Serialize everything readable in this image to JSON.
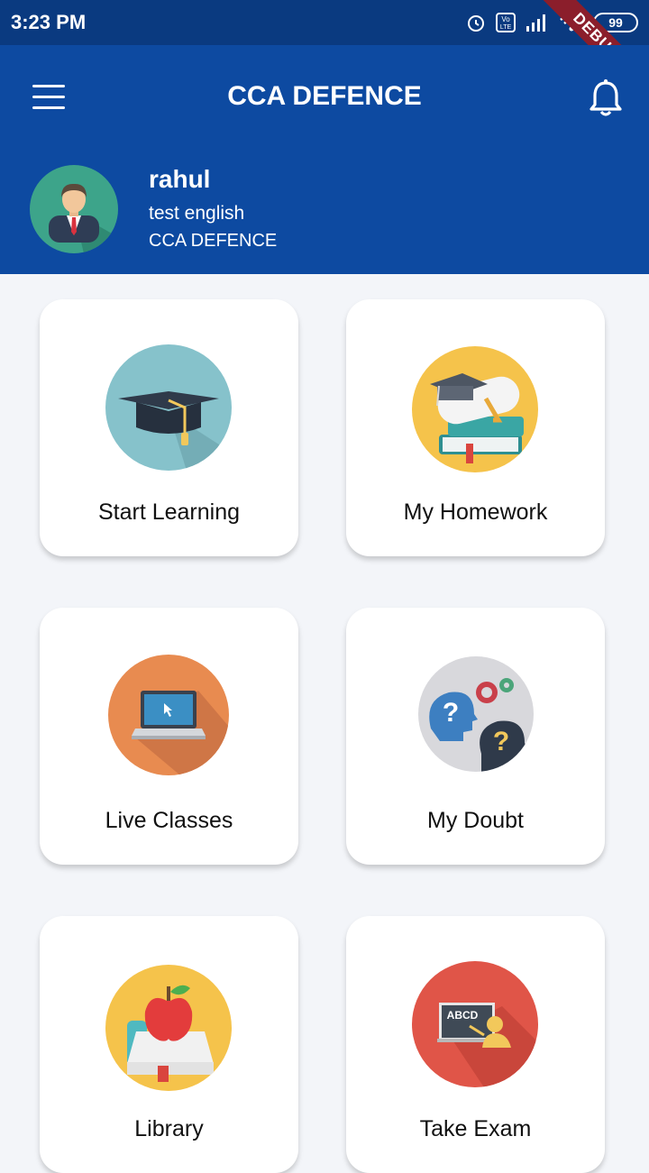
{
  "status_bar": {
    "time": "3:23 PM",
    "battery": "99"
  },
  "debug_ribbon": "DEBUG",
  "app_bar": {
    "title": "CCA DEFENCE"
  },
  "profile": {
    "name": "rahul",
    "course": "test english",
    "organization": "CCA DEFENCE"
  },
  "menu": [
    {
      "label": "Start Learning",
      "icon": "graduation-cap-icon"
    },
    {
      "label": "My Homework",
      "icon": "homework-books-icon"
    },
    {
      "label": "Live Classes",
      "icon": "laptop-icon"
    },
    {
      "label": "My Doubt",
      "icon": "question-heads-icon"
    },
    {
      "label": "Library",
      "icon": "apple-book-icon"
    },
    {
      "label": "Take Exam",
      "icon": "teacher-board-icon"
    }
  ],
  "board_text": "ABCD"
}
